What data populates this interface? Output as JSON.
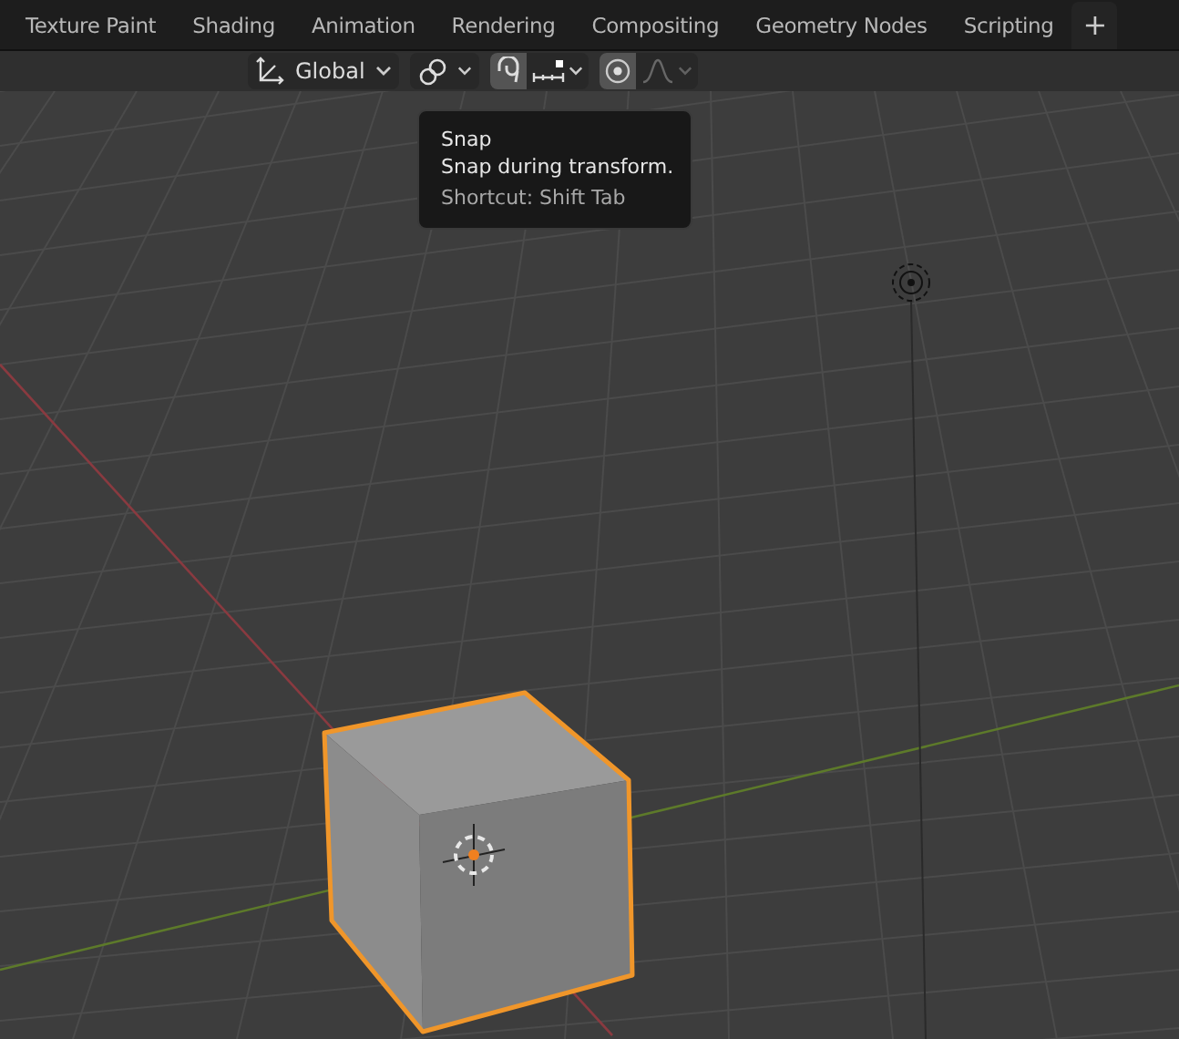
{
  "workspace_tabs": [
    {
      "label": "Texture Paint",
      "selected": false
    },
    {
      "label": "Shading",
      "selected": false
    },
    {
      "label": "Animation",
      "selected": false
    },
    {
      "label": "Rendering",
      "selected": false
    },
    {
      "label": "Compositing",
      "selected": false
    },
    {
      "label": "Geometry Nodes",
      "selected": false
    },
    {
      "label": "Scripting",
      "selected": false
    }
  ],
  "add_tab": "+",
  "header": {
    "orientation": "Global",
    "snap": {
      "on": true
    },
    "proportional_editing": {
      "on": true
    },
    "falloff": {
      "disabled": true
    }
  },
  "tooltip": {
    "title": "Snap",
    "description": "Snap during transform.",
    "shortcut": "Shortcut: Shift Tab"
  }
}
